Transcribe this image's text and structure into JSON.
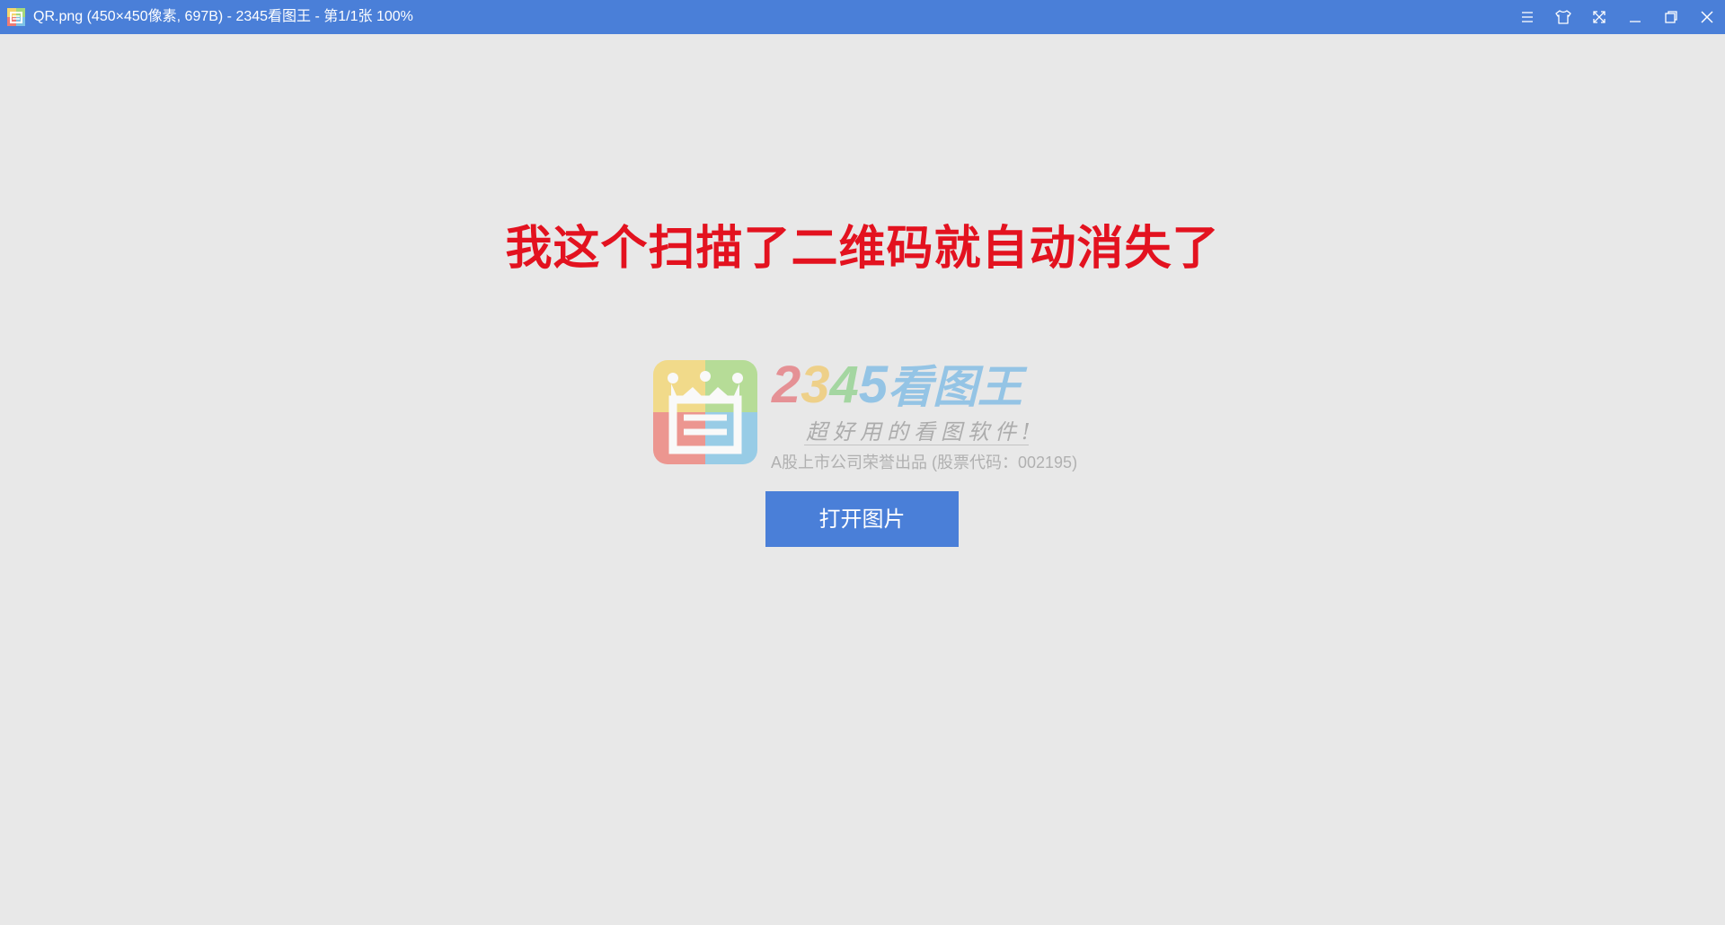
{
  "window": {
    "title": "QR.png  (450×450像素, 697B)  - 2345看图王 - 第1/1张 100%",
    "controls": [
      {
        "name": "menu-icon"
      },
      {
        "name": "skin-icon"
      },
      {
        "name": "fullscreen-icon"
      },
      {
        "name": "minimize-icon"
      },
      {
        "name": "restore-icon"
      },
      {
        "name": "close-icon"
      }
    ],
    "accent_color": "#4a7fd8"
  },
  "content": {
    "headline": "我这个扫描了二维码就自动消失了",
    "headline_color": "#e3121f"
  },
  "branding": {
    "brand_digits": [
      "2",
      "3",
      "4",
      "5"
    ],
    "brand_cn": "看图王",
    "slogan": "超好用的看图软件!",
    "company_note": "A股上市公司荣誉出品 (股票代码：002195)"
  },
  "actions": {
    "open_image_label": "打开图片"
  }
}
